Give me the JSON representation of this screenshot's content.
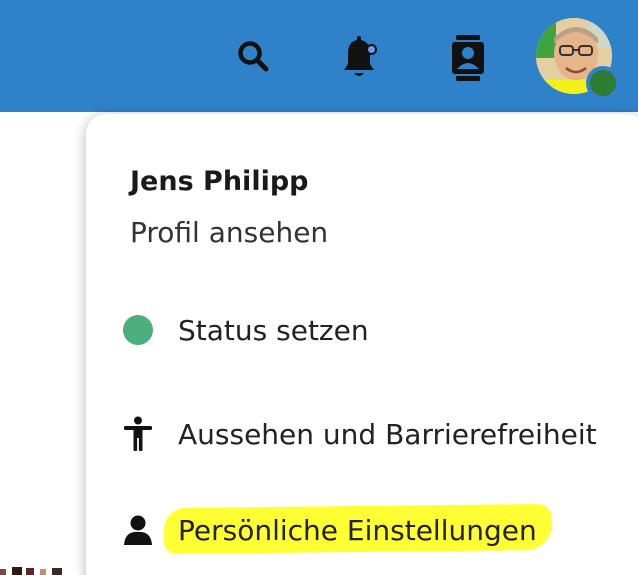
{
  "header": {
    "search_icon": "search-icon",
    "notifications_icon": "bell-icon",
    "contacts_icon": "contacts-icon",
    "avatar_status_color": "#2e7d32",
    "header_color": "#2f82c9"
  },
  "user_menu": {
    "name": "Jens Philipp",
    "profile_link": "Profil ansehen",
    "items": [
      {
        "label": "Status setzen",
        "icon": "status-online-dot",
        "icon_color": "#4caf7d"
      },
      {
        "label": "Aussehen und Barrierefreiheit",
        "icon": "accessibility-icon"
      },
      {
        "label": "Persönliche Einstellungen",
        "icon": "user-icon",
        "highlighted": true,
        "highlight_color": "#ffff33"
      }
    ]
  }
}
